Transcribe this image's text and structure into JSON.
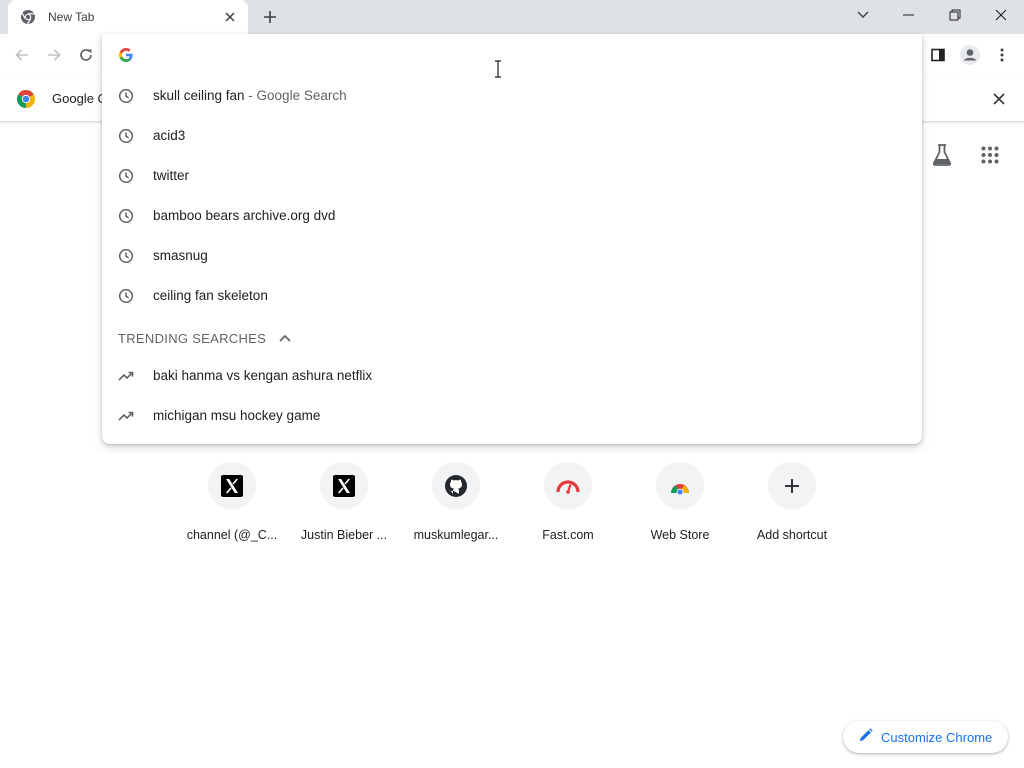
{
  "tab": {
    "title": "New Tab",
    "favicon": "chrome-icon"
  },
  "window_controls": {
    "icons": [
      "tab-search-icon",
      "minimize-icon",
      "restore-icon",
      "close-icon"
    ]
  },
  "toolbar": {
    "icons": [
      "back-icon",
      "forward-icon",
      "reload-icon",
      "side-panel-icon",
      "profile-icon",
      "kebab-menu-icon"
    ]
  },
  "infobar": {
    "text": "Google C"
  },
  "omnibox": {
    "value": "",
    "suggestions": [
      {
        "text": "skull ceiling fan",
        "sub": " - Google Search",
        "icon": "history-icon"
      },
      {
        "text": "acid3",
        "sub": "",
        "icon": "history-icon"
      },
      {
        "text": "twitter",
        "sub": "",
        "icon": "history-icon"
      },
      {
        "text": "bamboo bears archive.org dvd",
        "sub": "",
        "icon": "history-icon"
      },
      {
        "text": "smasnug",
        "sub": "",
        "icon": "history-icon"
      },
      {
        "text": "ceiling fan skeleton",
        "sub": "",
        "icon": "history-icon"
      }
    ],
    "trending_header": "TRENDING SEARCHES",
    "trending": [
      {
        "text": "baki hanma vs kengan ashura netflix",
        "icon": "trending-icon"
      },
      {
        "text": "michigan msu hockey game",
        "icon": "trending-icon"
      }
    ]
  },
  "shortcuts": [
    {
      "label": "channel (@_C...",
      "icon": "x-logo-icon"
    },
    {
      "label": "Justin Bieber ...",
      "icon": "x-logo-icon"
    },
    {
      "label": "muskumlegar...",
      "icon": "github-icon"
    },
    {
      "label": "Fast.com",
      "icon": "speedometer-icon"
    },
    {
      "label": "Web Store",
      "icon": "web-store-icon"
    },
    {
      "label": "Add shortcut",
      "icon": "plus-icon"
    }
  ],
  "customize": {
    "label": "Customize Chrome",
    "icon": "pencil-icon"
  },
  "colors": {
    "accent": "#1a73e8",
    "tab_strip": "#dee1e6",
    "tile_bg": "#f1f3f4",
    "icon_gray": "#5f6368"
  }
}
